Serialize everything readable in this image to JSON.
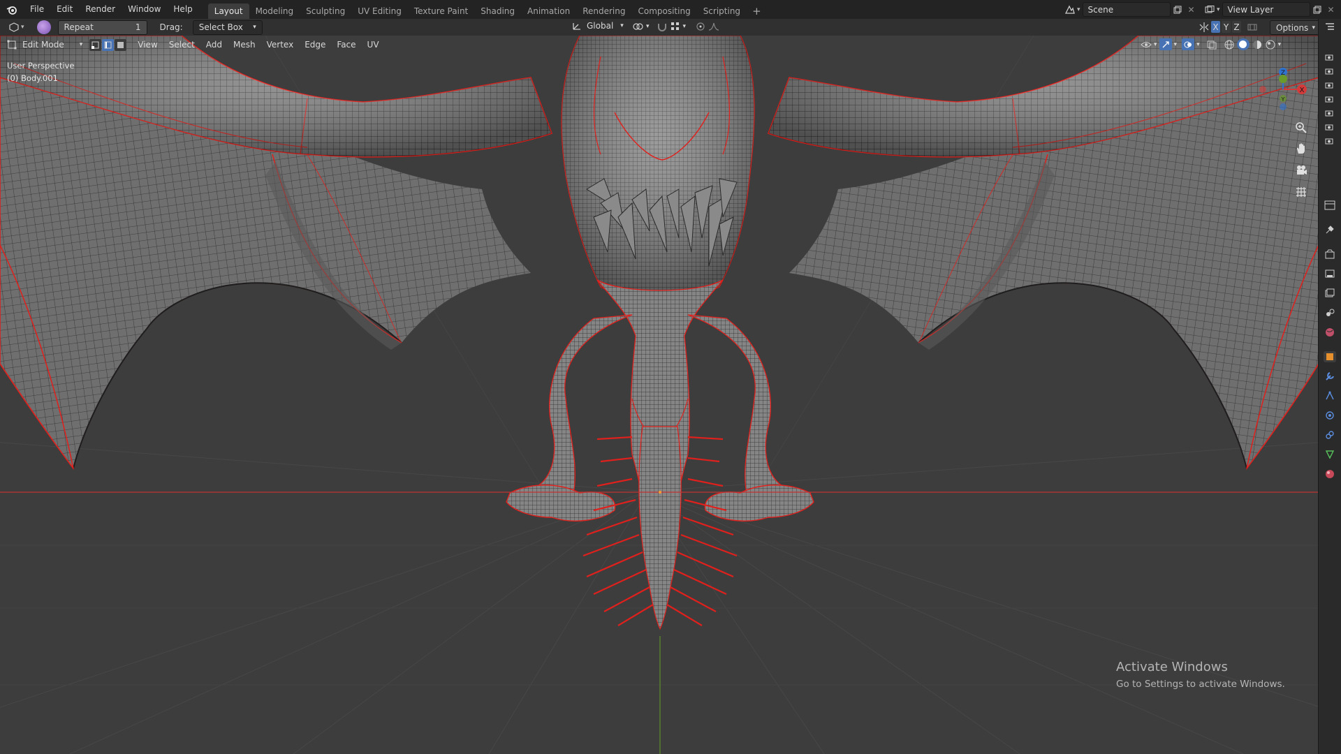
{
  "menus": [
    "File",
    "Edit",
    "Render",
    "Window",
    "Help"
  ],
  "workspaces": [
    {
      "label": "Layout",
      "active": true
    },
    {
      "label": "Modeling",
      "active": false
    },
    {
      "label": "Sculpting",
      "active": false
    },
    {
      "label": "UV Editing",
      "active": false
    },
    {
      "label": "Texture Paint",
      "active": false
    },
    {
      "label": "Shading",
      "active": false
    },
    {
      "label": "Animation",
      "active": false
    },
    {
      "label": "Rendering",
      "active": false
    },
    {
      "label": "Compositing",
      "active": false
    },
    {
      "label": "Scripting",
      "active": false
    }
  ],
  "add_tab": "+",
  "scene": {
    "label": "Scene"
  },
  "view_layer": {
    "label": "View Layer"
  },
  "tool_header": {
    "repeat_label": "Repeat",
    "repeat_count": "1",
    "drag_label": "Drag:",
    "drag_value": "Select Box",
    "orientation": "Global",
    "options_label": "Options",
    "axes": [
      "X",
      "Y",
      "Z"
    ]
  },
  "viewport_header": {
    "mode": "Edit Mode",
    "menus": [
      "View",
      "Select",
      "Add",
      "Mesh",
      "Vertex",
      "Edge",
      "Face",
      "UV"
    ]
  },
  "overlay": {
    "perspective": "User Perspective",
    "object": "(0) Body.001"
  },
  "gizmo": {
    "x": "X",
    "y": "Y",
    "z": "Z"
  },
  "watermark": {
    "title": "Activate Windows",
    "subtitle": "Go to Settings to activate Windows."
  },
  "colors": {
    "accent": "#4772b3",
    "x_axis": "#d43a3a",
    "y_axis": "#6a9a2a",
    "z_axis": "#2f73d1",
    "seam": "#e0201c"
  }
}
